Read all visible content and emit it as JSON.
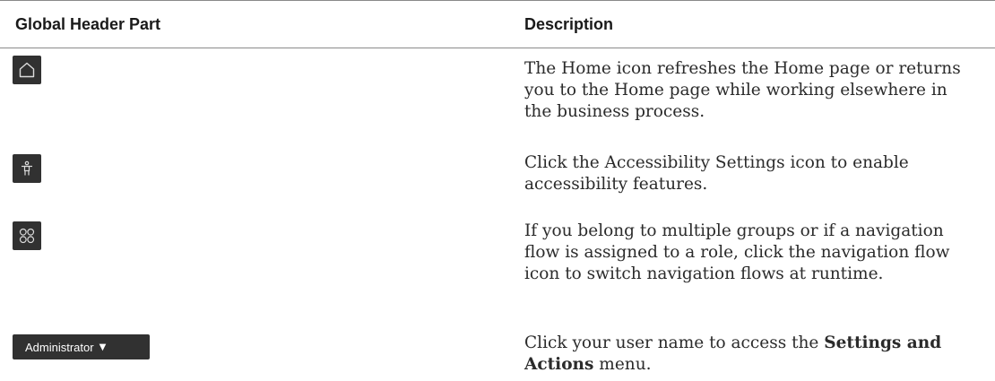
{
  "table": {
    "headers": {
      "part": "Global Header Part",
      "description": "Description"
    },
    "rows": [
      {
        "icon": "home-icon",
        "description": "The Home icon refreshes the Home page or returns you to the Home page while working elsewhere in the business process."
      },
      {
        "icon": "accessibility-icon",
        "description": "Click the Accessibility Settings icon to enable accessibility features."
      },
      {
        "icon": "navigation-flow-icon",
        "description": "If you belong to multiple groups or if a navigation flow is assigned to a role, click the navigation flow icon to switch navigation flows at runtime."
      },
      {
        "button_label": "Administrator",
        "icon": "caret-down-icon",
        "description_before": "Click your user name to access the ",
        "description_bold": "Settings and Actions",
        "description_after": " menu."
      }
    ]
  },
  "colors": {
    "icon_background": "#313131",
    "icon_stroke": "#dcdcdc",
    "rule": "#8a8a8a",
    "text": "#2b2b2b"
  }
}
